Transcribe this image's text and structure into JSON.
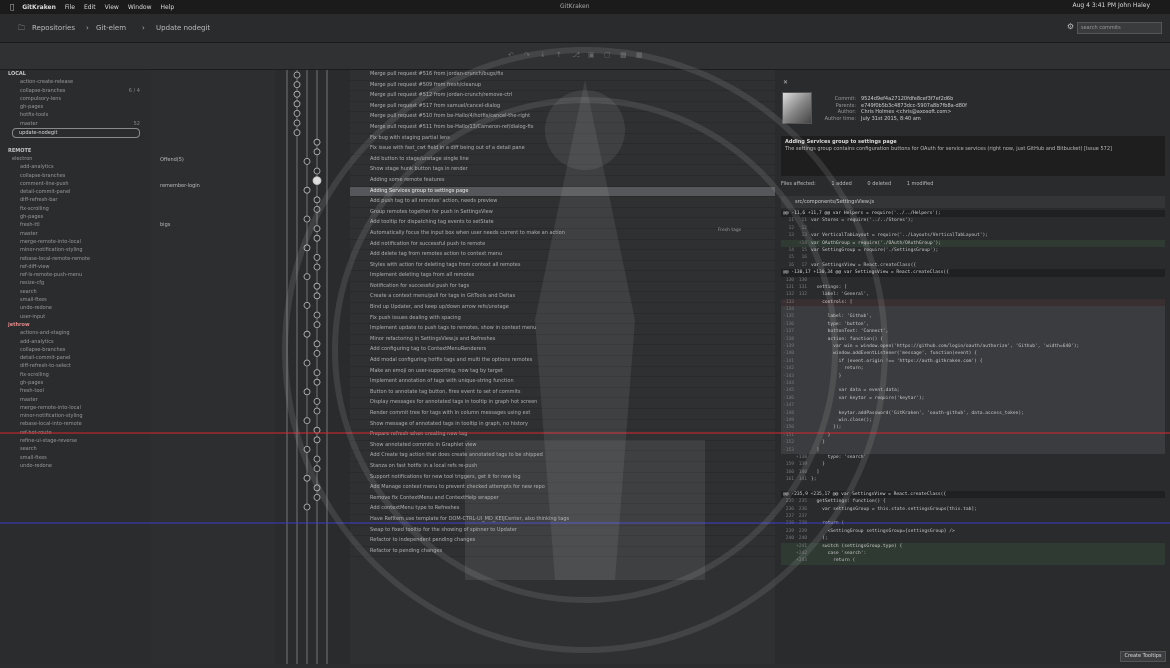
{
  "menubar": {
    "app_name": "GitKraken",
    "items": [
      "File",
      "Edit",
      "View",
      "Window",
      "Help"
    ],
    "title": "GitKraken",
    "status": "Aug 4  3:41 PM   John Haley"
  },
  "toolbar": {
    "breadcrumb": [
      "Repositories",
      "Git-elem",
      "Update nodegit"
    ],
    "search_placeholder": "search commits"
  },
  "sidebar": {
    "local_header": "LOCAL",
    "local_items": [
      {
        "label": "action-create-release",
        "count": ""
      },
      {
        "label": "collapse-branches",
        "count": "6 / 4"
      },
      {
        "label": "compulsory-lens",
        "count": ""
      },
      {
        "label": "gh-pages",
        "count": ""
      },
      {
        "label": "hotfix-tools",
        "count": ""
      },
      {
        "label": "master",
        "count": "52"
      },
      {
        "label": "update-nodegit",
        "count": "",
        "selected": true
      }
    ],
    "remote_header": "REMOTE",
    "remote_sub": "electron",
    "remote_items": [
      "add-analytics",
      "collapse-branches",
      "comment-line-push",
      "detail-commit-panel",
      "diff-refresh-bar",
      "fix-scrolling",
      "gh-pages",
      "fresh-ttl",
      "master",
      "merge-remote-into-local",
      "minor-notification-styling",
      "rebase-local-remote-remote",
      "ref-diff-view",
      "ref-ls-remote-push-menu",
      "resize-cfg",
      "search",
      "small-fixes",
      "undo-redone",
      "user-input"
    ],
    "second_header": "jethrow",
    "second_items": [
      "actions-and-staging",
      "add-analytics",
      "collapse-branches",
      "detail-commit-panel",
      "diff-refresh-to-select",
      "fix-scrolling",
      "gh-pages",
      "fresh-tool",
      "master",
      "merge-remote-into-local",
      "minor-notification-styling",
      "rebase-local-into-remote",
      "ref-hot-route",
      "refine-ui-stage-reverse",
      "search",
      "small-fixes",
      "undo-redone"
    ]
  },
  "labels": {
    "label1": "Offend(5)",
    "label2": "remember-login",
    "label3": "bigs",
    "tag_badge": "Fresh tags"
  },
  "commits": [
    "Merge pull request #516 from jordan-crunch/bugs/fix",
    "Merge pull request #509 from fresh/cleanup",
    "Merge pull request #512 from jordan-crunch/remove-ctrl",
    "Merge pull request #517 from samuel/cancel-dialog",
    "Merge pull request #510 from be-Hallo/4/hotfix/cancel-the-right",
    "Merge pull request #511 from be-Hallo/13/Cameron-ref/dialog-fix",
    "Fix bug with staging partial lens",
    "Fix issue with fast_cwt field in a diff being out of a detail pane",
    "Add button to stage/unstage single line",
    "Show stage hunk button tags in render",
    "Adding some remote features",
    "Adding Services group to settings page",
    "Add push tag to all remotes' action, needs preview",
    "Group remotes together for push in SettingsView",
    "Add tooltip for dispatching tag events to setState",
    "Automatically focus the input box when user needs current to make an action",
    "Add notification for successful push to remote",
    "Add delete tag from remotes action to context menu",
    "Styles with action for deleting tags from context all remotes",
    "Implement deleting tags from all remotes",
    "Notification for successful push for tags",
    "Create a context menu/pull for tags in GitTools and Deltas",
    "Bind up Updater, and keep up/down arrow refs/unstage",
    "Fix push issues dealing with spacing",
    "Implement update to push tags to remotes, show in context menu",
    "Minor refactoring in SettingsView.js and Refreshes",
    "Add configuring tag to ContextMenuRenderers",
    "Add modal configuring hotfix tags and multi the options remotes",
    "Make an emoji on user-supporting, now tag by target",
    "Implement annotation of tags with unique-string function",
    "Button to annotate tag button, fires event to set of commits",
    "Display messages for annotated tags in tooltip in graph hot screen",
    "Render commit tree for tags with in column messages using ext",
    "Show message of annotated tags in tooltip in graph, no history",
    "Prepare refresh when creating new tag",
    "Show annotated commits in Graphlet view",
    "Add Create tag action that does create annotated tags to be shipped",
    "Stanza on fast hotfix in a local refs re-push",
    "Support notifications for new tool triggers, get it for new log",
    "Add Manage context menu to prevent checked attempts for new repo",
    "Remove fix ContextMenu and ContextHelp wrapper",
    "Add contextMenu type to Refreshes",
    "Have RefItem use template for DOM-CTRL-UI_MD_KEIJCenter, also thinking tags",
    "Swap to fixed tooltip for the showing of spinner to Updater",
    "Refactor to independent pending changes",
    "Refactor to pending changes"
  ],
  "detail": {
    "commit_label": "Commit:",
    "commit_value": "9524d9ef4a27120fdfe8cef3f7ef2d6b",
    "parents_label": "Parents:",
    "parents_value": "e749f0b5b3c4873dcc-5907a8b7fb8a-d80f",
    "author_label": "Author:",
    "author_value": "Chris Holmes <chris@axosoft.com>",
    "time_label": "Author time:",
    "time_value": "July 31st 2015, 8:40 am",
    "subject": "Adding Services group to settings page",
    "body": "The settings group contains configuration buttons for OAuth for service services (right now, just GitHub and Bitbucket) [Issue 572]",
    "files_affected": "Files affected:",
    "added": "1 added",
    "deleted": "0 deleted",
    "modified": "1 modified",
    "file_path": "src/components/SettingsView.js"
  },
  "diff_lines": [
    {
      "k": "hunk",
      "a": "",
      "b": "",
      "t": "@@ -11,6 +11,7 @@ var Helpers = require('../../Helpers');"
    },
    {
      "k": "ctx",
      "a": "11",
      "b": "11",
      "t": "var Stores = require('../../Stores');"
    },
    {
      "k": "ctx",
      "a": "12",
      "b": "12",
      "t": ""
    },
    {
      "k": "ctx",
      "a": "13",
      "b": "13",
      "t": "var VerticalTabLayout = require('../Layouts/VerticalTabLayout');"
    },
    {
      "k": "add",
      "a": "",
      "b": "+14",
      "t": "var OAuthGroup = require('./OAuth/OAuthGroup');"
    },
    {
      "k": "ctx",
      "a": "14",
      "b": "15",
      "t": "var SettingGroup = require('./SettingsGroup');"
    },
    {
      "k": "ctx",
      "a": "15",
      "b": "16",
      "t": ""
    },
    {
      "k": "ctx",
      "a": "16",
      "b": "17",
      "t": "var SettingsView = React.createClass({"
    },
    {
      "k": "hunk",
      "a": "",
      "b": "",
      "t": "@@ -130,17 +130,34 @@ var SettingsView = React.createClass({"
    },
    {
      "k": "ctx",
      "a": "130",
      "b": "130",
      "t": ""
    },
    {
      "k": "ctx",
      "a": "131",
      "b": "131",
      "t": "  settings: ["
    },
    {
      "k": "ctx",
      "a": "132",
      "b": "132",
      "t": "    label: 'General',"
    },
    {
      "k": "del",
      "a": "-133",
      "b": "",
      "t": "    controls: ["
    },
    {
      "k": "rem",
      "a": "-134",
      "b": "",
      "t": ""
    },
    {
      "k": "rem",
      "a": "-135",
      "b": "",
      "t": "      label: 'Github',"
    },
    {
      "k": "rem",
      "a": "-136",
      "b": "",
      "t": "      type: 'button',"
    },
    {
      "k": "rem",
      "a": "-137",
      "b": "",
      "t": "      buttonText: 'Connect',"
    },
    {
      "k": "rem",
      "a": "-138",
      "b": "",
      "t": "      action: function() {"
    },
    {
      "k": "rem",
      "a": "-139",
      "b": "",
      "t": "        var win = window.open('https://github.com/login/oauth/authorize', 'Github', 'width=640');"
    },
    {
      "k": "rem",
      "a": "-140",
      "b": "",
      "t": "        window.addEventListener('message', function(event) {"
    },
    {
      "k": "rem",
      "a": "-141",
      "b": "",
      "t": "          if (event.origin !== 'https://auth.gitkraken.com') {"
    },
    {
      "k": "rem",
      "a": "-142",
      "b": "",
      "t": "            return;"
    },
    {
      "k": "rem",
      "a": "-143",
      "b": "",
      "t": "          }"
    },
    {
      "k": "rem",
      "a": "-144",
      "b": "",
      "t": ""
    },
    {
      "k": "rem",
      "a": "-145",
      "b": "",
      "t": "          var data = event.data;"
    },
    {
      "k": "rem",
      "a": "-146",
      "b": "",
      "t": "          var keytar = require('keytar');"
    },
    {
      "k": "rem",
      "a": "-147",
      "b": "",
      "t": ""
    },
    {
      "k": "rem",
      "a": "-148",
      "b": "",
      "t": "          keytar.addPassword('GitKraken', 'oauth-github', data.access_token);"
    },
    {
      "k": "rem",
      "a": "-149",
      "b": "",
      "t": "          win.close();"
    },
    {
      "k": "rem",
      "a": "-150",
      "b": "",
      "t": "        });"
    },
    {
      "k": "rem",
      "a": "-151",
      "b": "",
      "t": "      }"
    },
    {
      "k": "rem",
      "a": "-152",
      "b": "",
      "t": "    }"
    },
    {
      "k": "rem",
      "a": "-153",
      "b": "",
      "t": "  ]"
    },
    {
      "k": "ctx",
      "a": "",
      "b": "+138",
      "t": "      type: 'search'"
    },
    {
      "k": "ctx",
      "a": "159",
      "b": "139",
      "t": "    }"
    },
    {
      "k": "ctx",
      "a": "160",
      "b": "140",
      "t": "  ]"
    },
    {
      "k": "ctx",
      "a": "161",
      "b": "141",
      "t": "};"
    },
    {
      "k": "ctx",
      "a": "",
      "b": "",
      "t": ""
    },
    {
      "k": "hunk",
      "a": "",
      "b": "",
      "t": "@@ -235,9 +235,17 @@ var SettingsView = React.createClass({"
    },
    {
      "k": "ctx",
      "a": "235",
      "b": "235",
      "t": "  getSettings: function() {"
    },
    {
      "k": "ctx",
      "a": "236",
      "b": "236",
      "t": "    var settingsGroup = this.state.settingsGroups[this.tab];"
    },
    {
      "k": "ctx",
      "a": "237",
      "b": "237",
      "t": ""
    },
    {
      "k": "ctx",
      "a": "238",
      "b": "238",
      "t": "    return ("
    },
    {
      "k": "ctx",
      "a": "239",
      "b": "239",
      "t": "      <SettingGroup settingsGroup={settingsGroup} />"
    },
    {
      "k": "ctx",
      "a": "240",
      "b": "240",
      "t": "    );"
    },
    {
      "k": "add",
      "a": "",
      "b": "+241",
      "t": "    switch (settingsGroup.type) {"
    },
    {
      "k": "add",
      "a": "",
      "b": "+242",
      "t": "      case 'search':"
    },
    {
      "k": "add",
      "a": "",
      "b": "+243",
      "t": "        return ("
    }
  ],
  "status_button": "Create Tooltips"
}
